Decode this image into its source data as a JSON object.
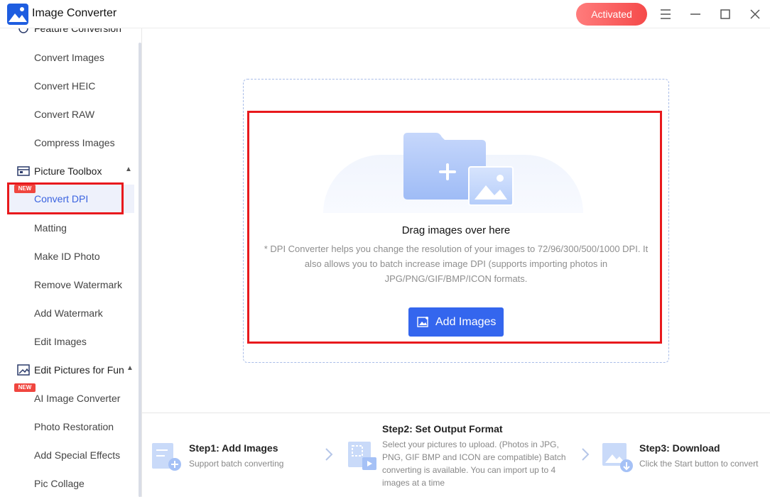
{
  "app": {
    "title": "Image Converter",
    "activated_label": "Activated"
  },
  "sidebar": {
    "sections": [
      {
        "label": "Feature Conversion",
        "icon": "feature-conversion-icon"
      },
      {
        "label": "Picture Toolbox",
        "icon": "toolbox-icon"
      },
      {
        "label": "Edit Pictures for Fun",
        "icon": "edit-pictures-icon"
      }
    ],
    "feature_items": [
      "Convert Images",
      "Convert HEIC",
      "Convert RAW",
      "Compress Images"
    ],
    "toolbox_items": [
      "Convert DPI",
      "Matting",
      "Make ID Photo",
      "Remove Watermark",
      "Add Watermark",
      "Edit Images"
    ],
    "fun_items": [
      "AI Image Converter",
      "Photo Restoration",
      "Add Special Effects",
      "Pic Collage"
    ],
    "new_badge": "NEW",
    "active_item": "Convert DPI"
  },
  "main": {
    "drag_title": "Drag images over here",
    "drag_desc": "* DPI Converter helps you change the resolution of your images to 72/96/300/500/1000 DPI. It also allows you to batch increase image DPI (supports importing photos in JPG/PNG/GIF/BMP/ICON formats.",
    "add_button": "Add Images"
  },
  "steps": [
    {
      "title": "Step1:  Add Images",
      "desc": "Support batch converting"
    },
    {
      "title": "Step2:  Set Output Format",
      "desc": "Select your pictures to upload. (Photos in JPG, PNG, GIF BMP and ICON are compatible) Batch converting is available. You can import up to 4 images at a time"
    },
    {
      "title": "Step3:  Download",
      "desc": "Click the Start button to convert"
    }
  ],
  "colors": {
    "accent": "#3466ee",
    "highlight": "#e8191d",
    "activated": "#f54a4a",
    "badge": "#f0463f"
  }
}
